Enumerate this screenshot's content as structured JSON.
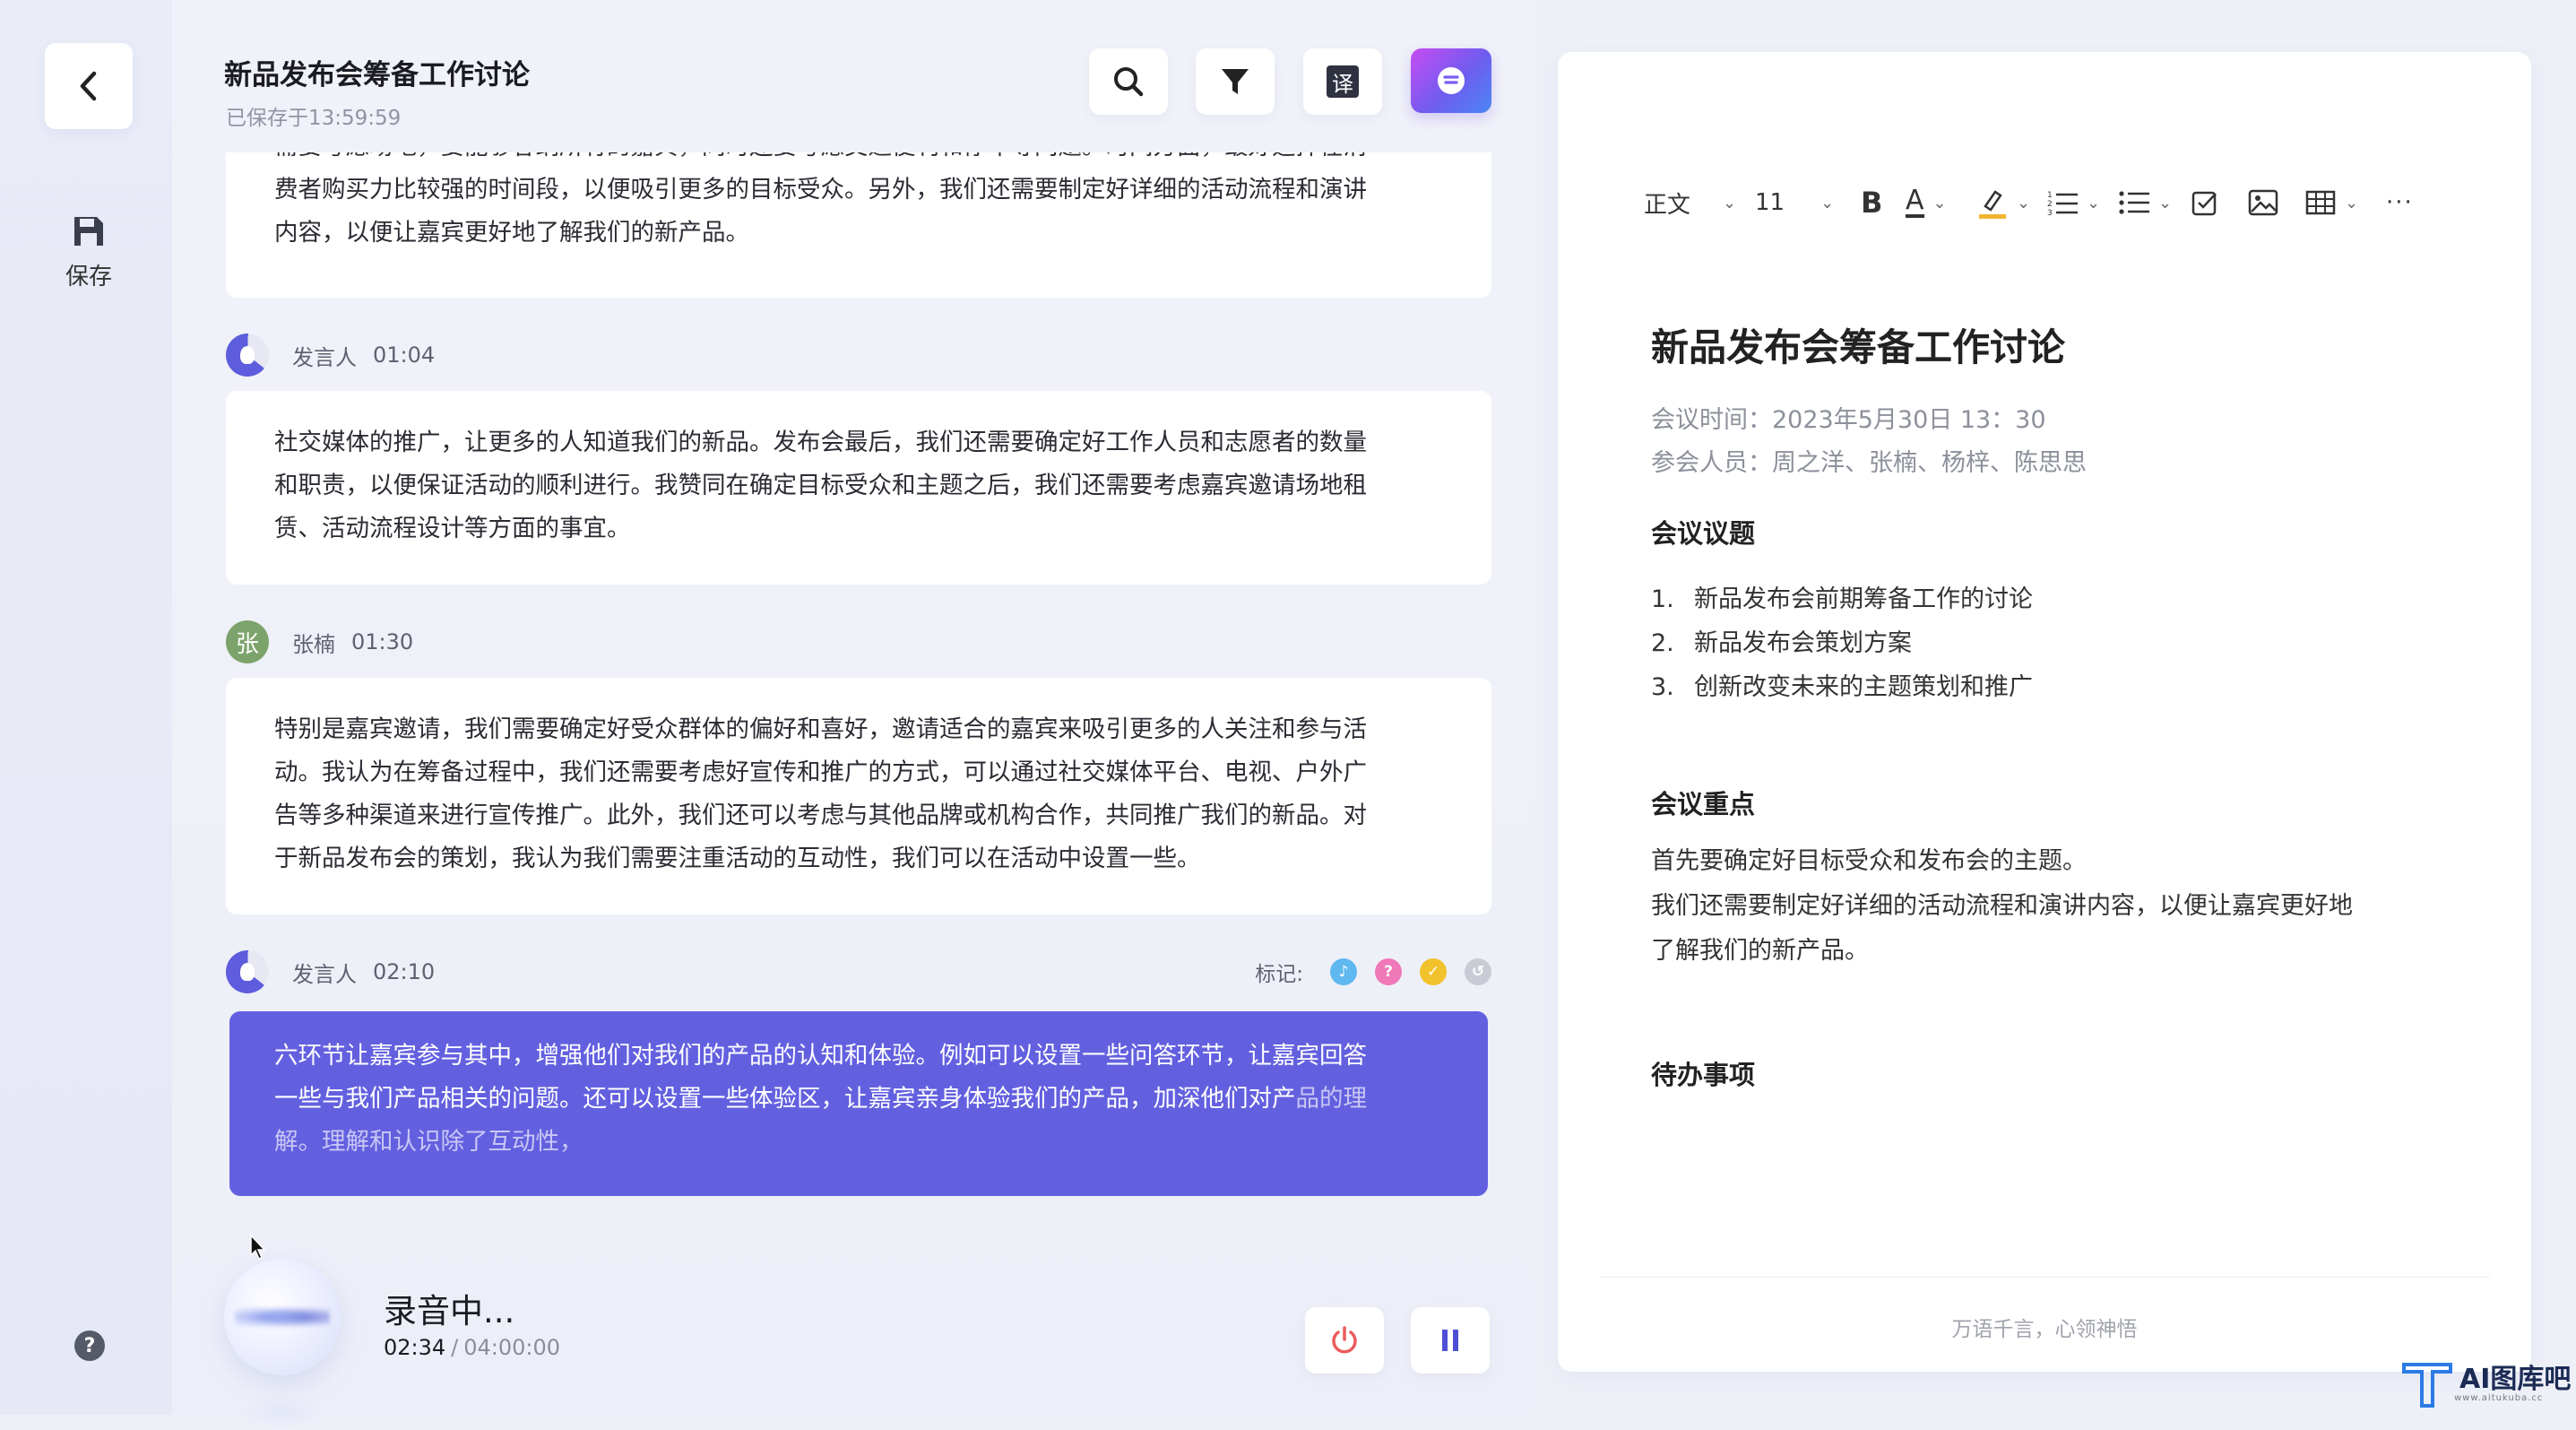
{
  "nav": {
    "save_label": "保存",
    "back_icon": "chevron-left-icon",
    "help_icon": "question-icon"
  },
  "document": {
    "title": "新品发布会筹备工作讨论",
    "saved": "已保存于13:59:59"
  },
  "toolbar_icons": [
    "search-icon",
    "filter-icon",
    "translate-icon",
    "ai-assistant-icon"
  ],
  "translate_glyph": "译",
  "transcript": {
    "truncated_first": {
      "lines": [
        "需要考虑场地，要能够容纳所有的嘉宾，同时还要考虑交通便利和停车等问题。时间方面，最好选择在消",
        "费者购买力比较强的时间段，以便吸引更多的目标受众。另外，我们还需要制定好详细的活动流程和演讲",
        "内容，以便让嘉宾更好地了解我们的新产品。"
      ]
    },
    "entries": [
      {
        "speaker": "发言人",
        "time": "01:04",
        "lines": [
          "社交媒体的推广，让更多的人知道我们的新品。发布会最后，我们还需要确定好工作人员和志愿者的数量",
          "和职责，以便保证活动的顺利进行。我赞同在确定目标受众和主题之后，我们还需要考虑嘉宾邀请场地租",
          "赁、活动流程设计等方面的事宜。"
        ]
      },
      {
        "speaker": "张楠",
        "avatar_char": "张",
        "time": "01:30",
        "lines": [
          "特别是嘉宾邀请，我们需要确定好受众群体的偏好和喜好，邀请适合的嘉宾来吸引更多的人关注和参与活",
          "动。我认为在筹备过程中，我们还需要考虑好宣传和推广的方式，可以通过社交媒体平台、电视、户外广",
          "告等多种渠道来进行宣传推广。此外，我们还可以考虑与其他品牌或机构合作，共同推广我们的新品。对",
          "于新品发布会的策划，我认为我们需要注重活动的互动性，我们可以在活动中设置一些。"
        ]
      },
      {
        "speaker": "发言人",
        "time": "02:10",
        "mark_label": "标记:",
        "marks": [
          {
            "icon": "bell-icon",
            "color": "#5fb8f0",
            "glyph": "♪"
          },
          {
            "icon": "question-mark-icon",
            "color": "#f078b8",
            "glyph": "?"
          },
          {
            "icon": "check-icon",
            "color": "#f2c22c",
            "glyph": "✓"
          },
          {
            "icon": "undo-icon",
            "color": "#c9ccd4",
            "glyph": "↺"
          }
        ],
        "line1": "六环节让嘉宾参与其中，增强他们对我们的产品的认知和体验。例如可以设置一些问答环节，让嘉宾回答",
        "line2_solid": "一些与我们产品相关的问题。还可以设置一些体验区，让嘉宾亲身体验我们的产品，加深他们对产",
        "line2_fade": "品的理",
        "line3_fade": "解。理解和认识除了互动性，"
      }
    ]
  },
  "recording": {
    "status": "录音中...",
    "elapsed": "02:34",
    "separator": "/",
    "total": "04:00:00"
  },
  "editor": {
    "toolbar": {
      "style": "正文",
      "font_size": "11"
    },
    "title": "新品发布会筹备工作讨论",
    "meeting_time": "会议时间：2023年5月30日 13：30",
    "attendees": "参会人员：周之洋、张楠、杨梓、陈思思",
    "agenda_heading": "会议议题",
    "agenda": [
      {
        "num": "1.",
        "text": "新品发布会前期筹备工作的讨论"
      },
      {
        "num": "2.",
        "text": "新品发布会策划方案"
      },
      {
        "num": "3.",
        "text": "创新改变未来的主题策划和推广"
      }
    ],
    "keypoints_heading": "会议重点",
    "keypoints": [
      "首先要确定好目标受众和发布会的主题。",
      "我们还需要制定好详细的活动流程和演讲内容，以便让嘉宾更好地",
      "了解我们的新产品。"
    ],
    "todo_heading": "待办事项",
    "footer": "万语千言，心领神悟"
  },
  "watermark": {
    "text": "AI图库吧",
    "sub": "www.aitukuba.cc"
  }
}
